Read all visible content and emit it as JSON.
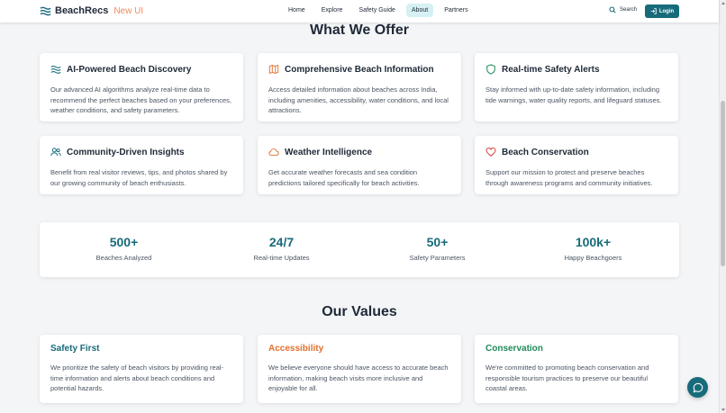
{
  "nav": {
    "brand": "BeachRecs",
    "brand_tag": "New UI",
    "links": [
      "Home",
      "Explore",
      "Safety Guide",
      "About",
      "Partners"
    ],
    "active_link": "About",
    "search_label": "Search",
    "login_label": "Login"
  },
  "offer": {
    "title": "What We Offer",
    "cards": [
      {
        "icon": "waves-icon",
        "title": "AI-Powered Beach Discovery",
        "desc": "Our advanced AI algorithms analyze real-time data to recommend the perfect beaches based on your preferences, weather conditions, and safety parameters."
      },
      {
        "icon": "map-icon",
        "title": "Comprehensive Beach Information",
        "desc": "Access detailed information about beaches across India, including amenities, accessibility, water conditions, and local attractions."
      },
      {
        "icon": "shield-icon",
        "title": "Real-time Safety Alerts",
        "desc": "Stay informed with up-to-date safety information, including tide warnings, water quality reports, and lifeguard statuses."
      },
      {
        "icon": "users-icon",
        "title": "Community-Driven Insights",
        "desc": "Benefit from real visitor reviews, tips, and photos shared by our growing community of beach enthusiasts."
      },
      {
        "icon": "cloud-icon",
        "title": "Weather Intelligence",
        "desc": "Get accurate weather forecasts and sea condition predictions tailored specifically for beach activities."
      },
      {
        "icon": "heart-icon",
        "title": "Beach Conservation",
        "desc": "Support our mission to protect and preserve beaches through awareness programs and community initiatives."
      }
    ]
  },
  "stats": [
    {
      "value": "500+",
      "label": "Beaches Analyzed"
    },
    {
      "value": "24/7",
      "label": "Real-time Updates"
    },
    {
      "value": "50+",
      "label": "Safety Parameters"
    },
    {
      "value": "100k+",
      "label": "Happy Beachgoers"
    }
  ],
  "values": {
    "title": "Our Values",
    "cards": [
      {
        "title": "Safety First",
        "color": "#176b7a",
        "desc": "We prioritize the safety of beach visitors by providing real-time information and alerts about beach conditions and potential hazards."
      },
      {
        "title": "Accessibility",
        "color": "#e0702f",
        "desc": "We believe everyone should have access to accurate beach information, making beach visits more inclusive and enjoyable for all."
      },
      {
        "title": "Conservation",
        "color": "#1f8a5a",
        "desc": "We're committed to promoting beach conservation and responsible tourism practices to preserve our beautiful coastal areas."
      }
    ]
  },
  "colors": {
    "accent": "#176b7a",
    "brand_tag": "#f08a5d",
    "icon_teal": "#176b7a",
    "icon_orange": "#e0702f",
    "icon_red": "#d64545"
  }
}
